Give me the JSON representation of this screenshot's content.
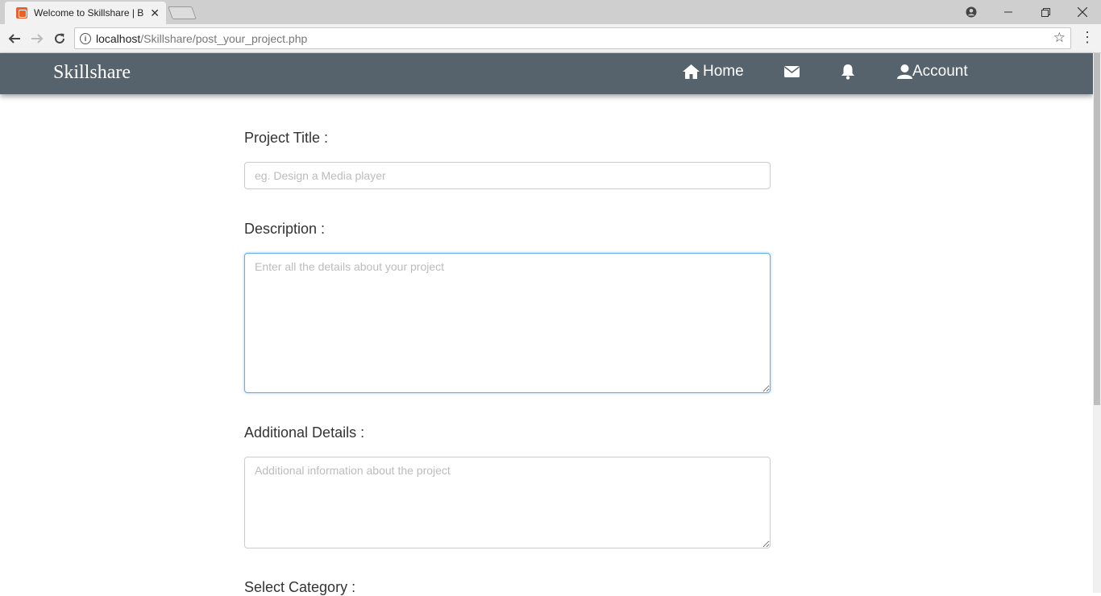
{
  "browser": {
    "tab_title": "Welcome to Skillshare | B",
    "tab_close": "✕",
    "url_host": "localhost",
    "url_path": "/Skillshare/post_your_project.php"
  },
  "navbar": {
    "brand": "Skillshare",
    "home_label": "Home",
    "account_label": "Account"
  },
  "form": {
    "title_label": "Project Title :",
    "title_placeholder": "eg. Design a Media player",
    "description_label": "Description :",
    "description_placeholder": "Enter all the details about your project",
    "additional_label": "Additional Details :",
    "additional_placeholder": "Additional information about the project",
    "category_label": "Select Category :"
  },
  "icons": {
    "home": "home-icon",
    "mail": "envelope-icon",
    "bell": "bell-icon",
    "user": "user-icon"
  }
}
